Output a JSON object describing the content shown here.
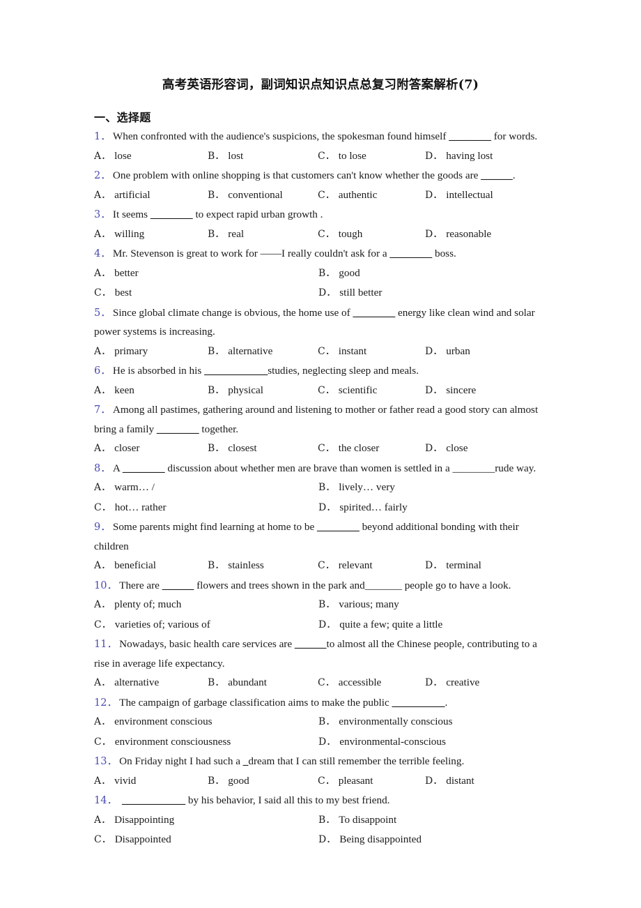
{
  "document": {
    "title": "高考英语形容词，副词知识点知识点总复习附答案解析(7)",
    "section_heading": "一、选择题",
    "number_color": "#4b4bb3",
    "text_color": "#1b1b1b"
  },
  "questions": [
    {
      "number": "1．",
      "stem_before": "When confronted with the audience's suspicions, the spokesman found himself ",
      "blank": "________",
      "stem_after": " for words.",
      "columns": 4,
      "options": [
        {
          "letter": "A．",
          "text": "lose"
        },
        {
          "letter": "B．",
          "text": "lost"
        },
        {
          "letter": "C．",
          "text": "to lose"
        },
        {
          "letter": "D．",
          "text": "having lost"
        }
      ]
    },
    {
      "number": "2．",
      "stem_before": "One problem with online shopping is that customers can't know whether the goods are ",
      "blank": "______",
      "stem_after": ".",
      "columns": 4,
      "options": [
        {
          "letter": "A．",
          "text": "artificial"
        },
        {
          "letter": "B．",
          "text": "conventional"
        },
        {
          "letter": "C．",
          "text": "authentic"
        },
        {
          "letter": "D．",
          "text": "intellectual"
        }
      ]
    },
    {
      "number": "3．",
      "stem_before": "It seems ",
      "blank": "________",
      "stem_after": " to expect rapid urban growth .",
      "columns": 4,
      "options": [
        {
          "letter": "A．",
          "text": "willing"
        },
        {
          "letter": "B．",
          "text": "real"
        },
        {
          "letter": "C．",
          "text": "tough"
        },
        {
          "letter": "D．",
          "text": "reasonable"
        }
      ]
    },
    {
      "number": "4．",
      "stem_before": "Mr. Stevenson is great to work for ——I really couldn't ask for a ",
      "blank": "________",
      "stem_after": "  boss.",
      "columns": 2,
      "options": [
        {
          "letter": "A．",
          "text": "better"
        },
        {
          "letter": "B．",
          "text": "good"
        },
        {
          "letter": "C．",
          "text": "best"
        },
        {
          "letter": "D．",
          "text": "still better"
        }
      ]
    },
    {
      "number": "5．",
      "stem_before": "Since global climate change is obvious, the home use of ",
      "blank": "________",
      "stem_after": " energy like clean wind and solar power systems is increasing.",
      "columns": 4,
      "options": [
        {
          "letter": "A．",
          "text": "primary"
        },
        {
          "letter": "B．",
          "text": "alternative"
        },
        {
          "letter": "C．",
          "text": "instant"
        },
        {
          "letter": "D．",
          "text": "urban"
        }
      ]
    },
    {
      "number": "6．",
      "stem_before": "He is absorbed in his ",
      "blank": "____________",
      "stem_after": "studies, neglecting sleep and meals.",
      "columns": 4,
      "options": [
        {
          "letter": "A．",
          "text": "keen"
        },
        {
          "letter": "B．",
          "text": "physical"
        },
        {
          "letter": "C．",
          "text": "scientific"
        },
        {
          "letter": "D．",
          "text": "sincere"
        }
      ]
    },
    {
      "number": "7．",
      "stem_before": "Among all pastimes, gathering around and listening to mother or father read a good story can almost bring a family ",
      "blank": "________",
      "stem_after": " together.",
      "columns": 4,
      "options": [
        {
          "letter": "A．",
          "text": "closer"
        },
        {
          "letter": "B．",
          "text": "closest"
        },
        {
          "letter": "C．",
          "text": "the closer"
        },
        {
          "letter": "D．",
          "text": "close"
        }
      ]
    },
    {
      "number": "8．",
      "stem_before": "A ",
      "blank": "________",
      "stem_after": " discussion about whether men are brave than women is settled in a ________rude way.",
      "columns": 2,
      "options": [
        {
          "letter": "A．",
          "text": "warm… /"
        },
        {
          "letter": "B．",
          "text": "lively… very"
        },
        {
          "letter": "C．",
          "text": "hot… rather"
        },
        {
          "letter": "D．",
          "text": "spirited… fairly"
        }
      ]
    },
    {
      "number": "9．",
      "stem_before": "Some parents might find learning at home to be ",
      "blank": "________",
      "stem_after": " beyond additional bonding with their children",
      "columns": 4,
      "options": [
        {
          "letter": "A．",
          "text": "beneficial"
        },
        {
          "letter": "B．",
          "text": "stainless"
        },
        {
          "letter": "C．",
          "text": "relevant"
        },
        {
          "letter": "D．",
          "text": "terminal"
        }
      ]
    },
    {
      "number": "10．",
      "stem_before": "There are ",
      "blank": "______",
      "stem_after": " flowers and trees shown in the park and_______ people go to have a look.",
      "columns": 2,
      "options": [
        {
          "letter": "A．",
          "text": "plenty of; much"
        },
        {
          "letter": "B．",
          "text": "various; many"
        },
        {
          "letter": "C．",
          "text": "varieties of; various of"
        },
        {
          "letter": "D．",
          "text": "quite a few; quite a little"
        }
      ]
    },
    {
      "number": "11．",
      "stem_before": "Nowadays, basic health care services are ",
      "blank": "______",
      "stem_after": "to almost all the Chinese people, contributing to a rise in average life expectancy.",
      "columns": 4,
      "options": [
        {
          "letter": "A．",
          "text": "alternative"
        },
        {
          "letter": "B．",
          "text": "abundant"
        },
        {
          "letter": "C．",
          "text": "accessible"
        },
        {
          "letter": "D．",
          "text": "creative"
        }
      ]
    },
    {
      "number": "12．",
      "stem_before": "The campaign of garbage classification aims to make the public ",
      "blank": "__________",
      "stem_after": ".",
      "columns": 2,
      "options": [
        {
          "letter": "A．",
          "text": "environment conscious"
        },
        {
          "letter": "B．",
          "text": "environmentally conscious"
        },
        {
          "letter": "C．",
          "text": "environment consciousness"
        },
        {
          "letter": "D．",
          "text": "environmental-conscious"
        }
      ]
    },
    {
      "number": "13．",
      "stem_before": "On Friday night I had such a ",
      "blank": "_",
      "stem_after": "dream that I can still remember the terrible feeling.",
      "columns": 4,
      "options": [
        {
          "letter": "A．",
          "text": "vivid"
        },
        {
          "letter": "B．",
          "text": "good"
        },
        {
          "letter": "C．",
          "text": "pleasant"
        },
        {
          "letter": "D．",
          "text": "distant"
        }
      ]
    },
    {
      "number": "14．",
      "stem_before": " ",
      "blank": "____________",
      "stem_after": " by his behavior, I said all this to my best friend.",
      "columns": 2,
      "options": [
        {
          "letter": "A．",
          "text": "Disappointing"
        },
        {
          "letter": "B．",
          "text": "To disappoint"
        },
        {
          "letter": "C．",
          "text": "Disappointed"
        },
        {
          "letter": "D．",
          "text": "Being disappointed"
        }
      ]
    }
  ]
}
